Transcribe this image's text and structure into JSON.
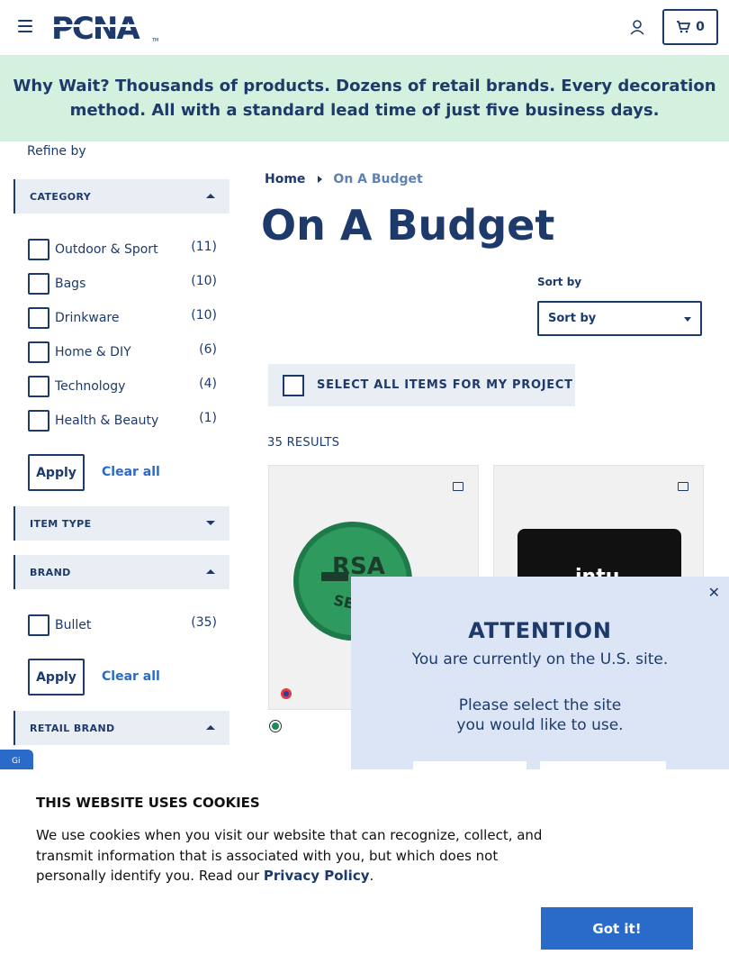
{
  "header": {
    "logo_text": "PCNA",
    "cart_count": "0"
  },
  "banner": {
    "text": "Why Wait? Thousands of products. Dozens of retail brands. Every decoration method. All with a standard lead time of just five business days."
  },
  "sidebar": {
    "refine_label": "Refine by",
    "category": {
      "title": "CATEGORY",
      "options": [
        {
          "label": "Outdoor & Sport",
          "count": "(11)"
        },
        {
          "label": "Bags",
          "count": "(10)"
        },
        {
          "label": "Drinkware",
          "count": "(10)"
        },
        {
          "label": "Home & DIY",
          "count": "(6)"
        },
        {
          "label": "Technology",
          "count": "(4)"
        },
        {
          "label": "Health & Beauty",
          "count": "(1)"
        }
      ]
    },
    "item_type": {
      "title": "ITEM TYPE"
    },
    "brand": {
      "title": "BRAND",
      "options": [
        {
          "label": "Bullet",
          "count": "(35)"
        }
      ]
    },
    "retail_brand": {
      "title": "RETAIL BRAND"
    },
    "apply_label": "Apply",
    "clear_label": "Clear all"
  },
  "main": {
    "breadcrumb": {
      "home": "Home",
      "current": "On A Budget"
    },
    "title": "On A Budget",
    "sort_label": "Sort by",
    "sort_value": "Sort by",
    "select_all": "SELECT ALL ITEMS FOR MY PROJECT",
    "results": "35 RESULTS",
    "products": [
      {
        "image_text": "RSA",
        "image_sub": "SECU"
      },
      {
        "image_text": "intu"
      }
    ]
  },
  "modal": {
    "title": "ATTENTION",
    "line1": "You are currently on the U.S. site.",
    "line2": "Please select the site you would like to use."
  },
  "cookie": {
    "title": "THIS WEBSITE USES COOKIES",
    "text_before": "We use cookies when you visit our website that can recognize, collect, and transmit information that is associated with you, but which does not personally identify you. Read our ",
    "link": "Privacy Policy",
    "text_after": ".",
    "button": "Got it!"
  },
  "colors": {
    "brand_navy": "#1d3a6b",
    "banner_green": "#d4f0de",
    "link_blue": "#2a6bc9"
  }
}
